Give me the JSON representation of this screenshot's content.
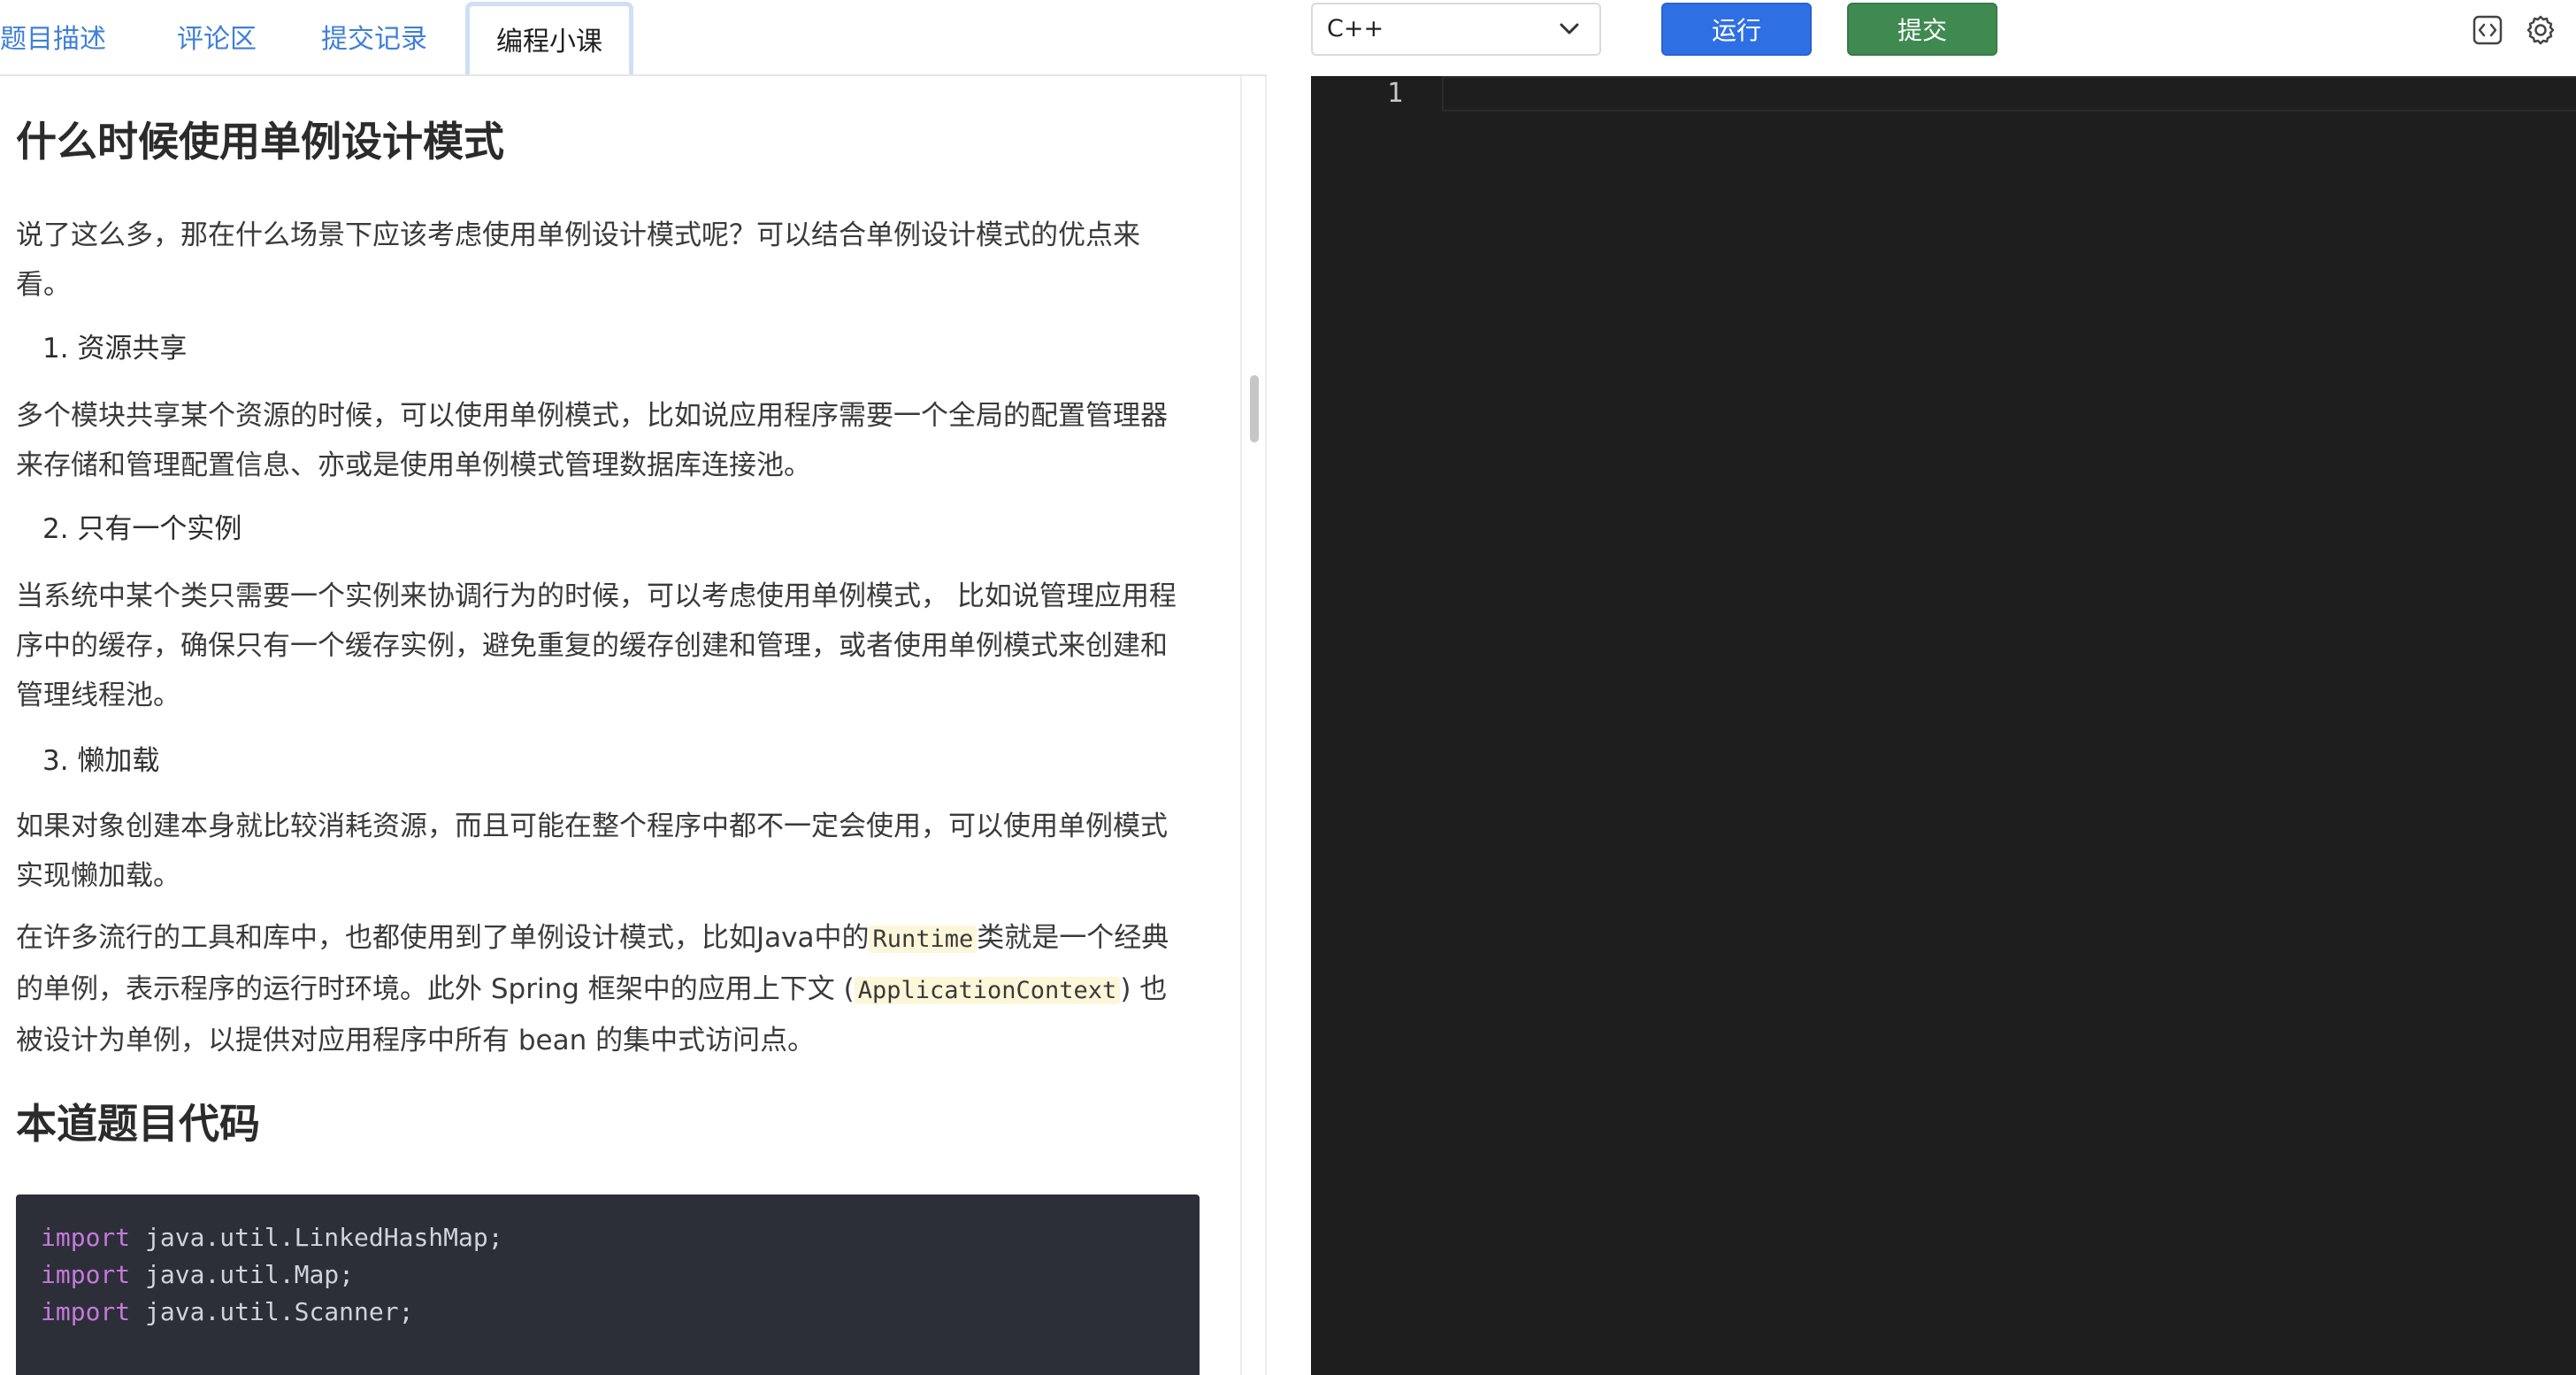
{
  "tabs": [
    {
      "label": "题目描述"
    },
    {
      "label": "评论区"
    },
    {
      "label": "提交记录"
    },
    {
      "label": "编程小课",
      "active": true
    }
  ],
  "article": {
    "heading1": "什么时候使用单例设计模式",
    "intro": "说了这么多，那在什么场景下应该考虑使用单例设计模式呢？可以结合单例设计模式的优点来看。",
    "items": [
      {
        "title": "1. 资源共享",
        "text": "多个模块共享某个资源的时候，可以使用单例模式，比如说应用程序需要一个全局的配置管理器来存储和管理配置信息、亦或是使用单例模式管理数据库连接池。"
      },
      {
        "title": "2. 只有一个实例",
        "text": "当系统中某个类只需要一个实例来协调行为的时候，可以考虑使用单例模式， 比如说管理应用程序中的缓存，确保只有一个缓存实例，避免重复的缓存创建和管理，或者使用单例模式来创建和管理线程池。"
      },
      {
        "title": "3. 懒加载",
        "text": "如果对象创建本身就比较消耗资源，而且可能在整个程序中都不一定会使用，可以使用单例模式实现懒加载。"
      }
    ],
    "closing": {
      "part1": "在许多流行的工具和库中，也都使用到了单例设计模式，比如Java中的",
      "code1": "Runtime",
      "part2": "类就是一个经典的单例，表示程序的运行时环境。此外 Spring 框架中的应用上下文 (",
      "code2": "ApplicationContext",
      "part3": ") 也被设计为单例，以提供对应用程序中所有 bean 的集中式访问点。"
    },
    "heading2": "本道题目代码",
    "code_lines": [
      {
        "kw": "import",
        "rest": " java.util.LinkedHashMap;"
      },
      {
        "kw": "import",
        "rest": " java.util.Map;"
      },
      {
        "kw": "import",
        "rest": " java.util.Scanner;"
      }
    ]
  },
  "toolbar": {
    "language": "C++",
    "run_label": "运行",
    "submit_label": "提交",
    "icons": [
      "code-icon",
      "gear-icon"
    ]
  },
  "editor": {
    "line_numbers": [
      "1"
    ]
  },
  "colors": {
    "tab_link": "#3f7fd8",
    "run_button": "#2f6fe4",
    "submit_button": "#3f8a50",
    "editor_bg": "#1e1e1e",
    "code_block_bg": "#2c2f38",
    "code_keyword": "#c678dd",
    "inline_code_bg": "#fdf7d9"
  }
}
